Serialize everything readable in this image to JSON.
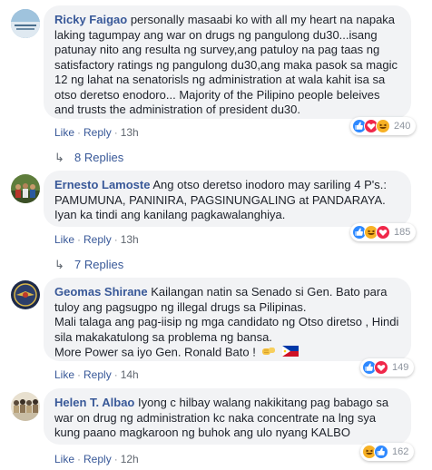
{
  "comments": [
    {
      "author": "Ricky Faigao",
      "text": "personally masaabi ko with all my heart na napaka laking tagumpay ang war on drugs ng pangulong du30...isang patunay nito ang resulta ng survey,ang patuloy na pag taas ng satisfactory ratings ng pangulong du30,ang maka pasok sa magic 12 ng lahat na senatorisls ng administration at wala kahit isa sa otso deretso enodoro... Majority of the Pilipino people beleives and trusts the administration of president du30.",
      "reaction_count": "240",
      "reactions": [
        "like-icon",
        "love-icon",
        "haha-icon"
      ],
      "like": "Like",
      "reply": "Reply",
      "time": "13h",
      "replies_label": "8 Replies"
    },
    {
      "author": "Ernesto Lamoste",
      "text": "Ang otso deretso inodoro may sariling 4 P's.: PAMUMUNA, PANINIRA, PAGSINUNGALING at PANDARAYA. Iyan ka tindi ang kanilang pagkawalanghiya.",
      "reaction_count": "185",
      "reactions": [
        "like-icon",
        "haha-icon",
        "love-icon"
      ],
      "like": "Like",
      "reply": "Reply",
      "time": "13h",
      "replies_label": "7 Replies"
    },
    {
      "author": "Geomas Shirane",
      "text_lines": [
        "Kailangan natin sa Senado si Gen. Bato para tuloy ang pagsugpo ng illegal drugs sa Pilipinas.",
        "Mali talaga ang pag-iisip ng mga candidato ng Otso diretso , Hindi sila makakatulong sa problema ng bansa.",
        "More Power sa iyo Gen. Ronald Bato !"
      ],
      "inline_emoji": [
        "fist-bump-icon",
        "philippine-flag-icon"
      ],
      "reaction_count": "149",
      "reactions": [
        "like-icon",
        "love-icon"
      ],
      "like": "Like",
      "reply": "Reply",
      "time": "14h"
    },
    {
      "author": "Helen T. Albao",
      "text": "Iyong c hilbay walang nakikitang pag babago sa war on drug ng administration kc naka concentrate na lng sya kung paano magkaroon ng buhok ang ulo nyang KALBO",
      "reaction_count": "162",
      "reactions": [
        "haha-icon",
        "like-icon"
      ],
      "like": "Like",
      "reply": "Reply",
      "time": "12h"
    }
  ],
  "colors": {
    "link": "#385898",
    "bubble": "#f2f3f5",
    "meta": "#606770"
  },
  "separator": "·",
  "reply_arrow": "↳"
}
